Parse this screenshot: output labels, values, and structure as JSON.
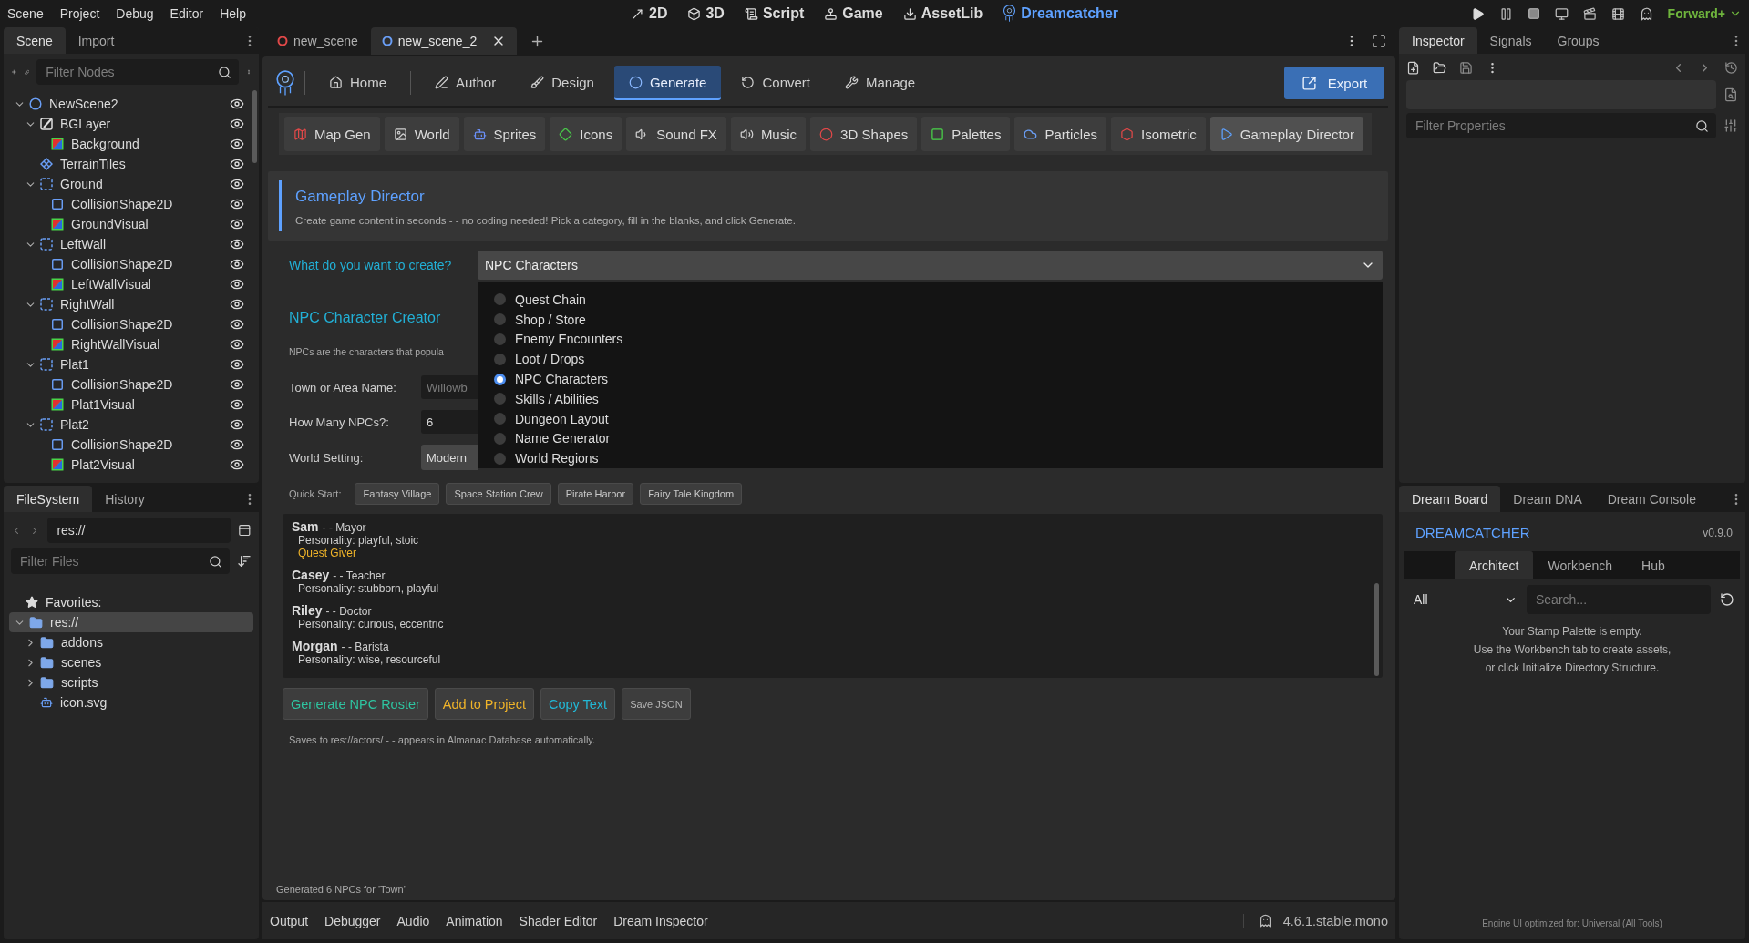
{
  "menu": [
    "Scene",
    "Project",
    "Debug",
    "Editor",
    "Help"
  ],
  "workspaces": [
    {
      "label": "2D",
      "selected": false
    },
    {
      "label": "3D",
      "selected": false
    },
    {
      "label": "Script",
      "selected": false
    },
    {
      "label": "Game",
      "selected": false
    },
    {
      "label": "AssetLib",
      "selected": false
    },
    {
      "label": "Dreamcatcher",
      "selected": true
    }
  ],
  "renderer": "Forward+",
  "scene_dock": {
    "tabs": [
      {
        "label": "Scene",
        "selected": true
      },
      {
        "label": "Import",
        "selected": false
      }
    ],
    "filter_placeholder": "Filter Nodes",
    "tree": [
      {
        "label": "NewScene2",
        "kind": "root",
        "expanded": true,
        "children": [
          {
            "label": "BGLayer",
            "kind": "layer",
            "expanded": true,
            "children": [
              {
                "label": "Background",
                "kind": "sprite"
              }
            ]
          },
          {
            "label": "TerrainTiles",
            "kind": "tiles"
          },
          {
            "label": "Ground",
            "kind": "body",
            "expanded": true,
            "children": [
              {
                "label": "CollisionShape2D",
                "kind": "shape"
              },
              {
                "label": "GroundVisual",
                "kind": "sprite"
              }
            ]
          },
          {
            "label": "LeftWall",
            "kind": "body",
            "expanded": true,
            "children": [
              {
                "label": "CollisionShape2D",
                "kind": "shape"
              },
              {
                "label": "LeftWallVisual",
                "kind": "sprite"
              }
            ]
          },
          {
            "label": "RightWall",
            "kind": "body",
            "expanded": true,
            "children": [
              {
                "label": "CollisionShape2D",
                "kind": "shape"
              },
              {
                "label": "RightWallVisual",
                "kind": "sprite"
              }
            ]
          },
          {
            "label": "Plat1",
            "kind": "body",
            "expanded": true,
            "children": [
              {
                "label": "CollisionShape2D",
                "kind": "shape"
              },
              {
                "label": "Plat1Visual",
                "kind": "sprite"
              }
            ]
          },
          {
            "label": "Plat2",
            "kind": "body",
            "expanded": true,
            "children": [
              {
                "label": "CollisionShape2D",
                "kind": "shape"
              },
              {
                "label": "Plat2Visual",
                "kind": "sprite"
              }
            ]
          }
        ]
      }
    ]
  },
  "filesystem_dock": {
    "tabs": [
      {
        "label": "FileSystem",
        "selected": true
      },
      {
        "label": "History",
        "selected": false
      }
    ],
    "path": "res://",
    "filter_placeholder": "Filter Files",
    "favorites": "Favorites:",
    "tree": [
      {
        "label": "res://",
        "kind": "folder",
        "selected": true,
        "expanded": true,
        "children": [
          {
            "label": "addons",
            "kind": "folder",
            "selected": false,
            "expanded": false
          },
          {
            "label": "scenes",
            "kind": "folder",
            "selected": false,
            "expanded": false
          },
          {
            "label": "scripts",
            "kind": "folder",
            "selected": false,
            "expanded": false
          },
          {
            "label": "icon.svg",
            "kind": "file",
            "selected": false
          }
        ]
      }
    ]
  },
  "scene_tabs": [
    {
      "label": "new_scene",
      "selected": false,
      "color": "#e04848"
    },
    {
      "label": "new_scene_2",
      "selected": true,
      "color": "#6a9ef5"
    }
  ],
  "plugin": {
    "nav": [
      {
        "label": "Home",
        "selected": false
      },
      {
        "label": "Author",
        "selected": false
      },
      {
        "label": "Design",
        "selected": false
      },
      {
        "label": "Generate",
        "selected": true
      },
      {
        "label": "Convert",
        "selected": false
      },
      {
        "label": "Manage",
        "selected": false
      }
    ],
    "export": "Export",
    "tools": [
      {
        "label": "Map Gen",
        "selected": false
      },
      {
        "label": "World",
        "selected": false
      },
      {
        "label": "Sprites",
        "selected": false
      },
      {
        "label": "Icons",
        "selected": false
      },
      {
        "label": "Sound FX",
        "selected": false
      },
      {
        "label": "Music",
        "selected": false
      },
      {
        "label": "3D Shapes",
        "selected": false
      },
      {
        "label": "Palettes",
        "selected": false
      },
      {
        "label": "Particles",
        "selected": false
      },
      {
        "label": "Isometric",
        "selected": false
      },
      {
        "label": "Gameplay Director",
        "selected": true
      }
    ],
    "header": {
      "title": "Gameplay Director",
      "subtitle": "Create game content in seconds - - no coding needed! Pick a category, fill in the blanks, and click Generate."
    },
    "create_label": "What do you want to create?",
    "create_value": "NPC Characters",
    "options": [
      {
        "label": "Quest Chain",
        "selected": false
      },
      {
        "label": "Shop / Store",
        "selected": false
      },
      {
        "label": "Enemy Encounters",
        "selected": false
      },
      {
        "label": "Loot / Drops",
        "selected": false
      },
      {
        "label": "NPC Characters",
        "selected": true
      },
      {
        "label": "Skills / Abilities",
        "selected": false
      },
      {
        "label": "Dungeon Layout",
        "selected": false
      },
      {
        "label": "Name Generator",
        "selected": false
      },
      {
        "label": "World Regions",
        "selected": false
      }
    ],
    "section_title": "NPC Character Creator",
    "description": "NPCs are the characters that popula",
    "fields": [
      {
        "label": "Town or Area Name:",
        "kind": "input",
        "placeholder": "Willowb"
      },
      {
        "label": "How Many NPCs?:",
        "kind": "input",
        "value": "6"
      },
      {
        "label": "World Setting:",
        "kind": "select",
        "value": "Modern"
      }
    ],
    "quick_start_label": "Quick Start:",
    "quick_start": [
      "Fantasy Village",
      "Space Station Crew",
      "Pirate Harbor",
      "Fairy Tale Kingdom"
    ],
    "npcs": [
      {
        "name": "Sam",
        "role": "- - Mayor",
        "personality": "Personality: playful, stoic",
        "tag": "Quest Giver"
      },
      {
        "name": "Casey",
        "role": "- - Teacher",
        "personality": "Personality: stubborn, playful"
      },
      {
        "name": "Riley",
        "role": "- - Doctor",
        "personality": "Personality: curious, eccentric"
      },
      {
        "name": "Morgan",
        "role": "- - Barista",
        "personality": "Personality: wise, resourceful"
      }
    ],
    "actions": [
      {
        "label": "Generate NPC Roster",
        "kind": "large",
        "color": "#2ec4a0"
      },
      {
        "label": "Add to Project",
        "kind": "large",
        "color": "#f0b429"
      },
      {
        "label": "Copy Text",
        "kind": "large",
        "color": "#22b8d6"
      },
      {
        "label": "Save JSON",
        "kind": "small",
        "color": "#b4b4b4"
      }
    ],
    "save_note": "Saves to res://actors/ - - appears in Almanac Database automatically.",
    "status": "Generated 6 NPCs for 'Town'"
  },
  "bottom_tabs": [
    "Output",
    "Debugger",
    "Audio",
    "Animation",
    "Shader Editor",
    "Dream Inspector"
  ],
  "engine_version": "4.6.1.stable.mono",
  "inspector": {
    "tabs": [
      {
        "label": "Inspector",
        "selected": true
      },
      {
        "label": "Signals",
        "selected": false
      },
      {
        "label": "Groups",
        "selected": false
      }
    ],
    "filter_placeholder": "Filter Properties"
  },
  "dream": {
    "tabs": [
      {
        "label": "Dream Board",
        "selected": true
      },
      {
        "label": "Dream DNA",
        "selected": false
      },
      {
        "label": "Dream Console",
        "selected": false
      }
    ],
    "brand": "DREAMCATCHER",
    "version": "v0.9.0",
    "subtabs": [
      {
        "label": "Architect",
        "selected": true
      },
      {
        "label": "Workbench",
        "selected": false
      },
      {
        "label": "Hub",
        "selected": false
      }
    ],
    "filter": "All",
    "search_placeholder": "Search...",
    "empty_lines": [
      "Your Stamp Palette is empty.",
      "Use the Workbench tab to create assets,",
      "or click Initialize Directory Structure."
    ],
    "footer": "Engine UI optimized for: Universal (All Tools)"
  }
}
